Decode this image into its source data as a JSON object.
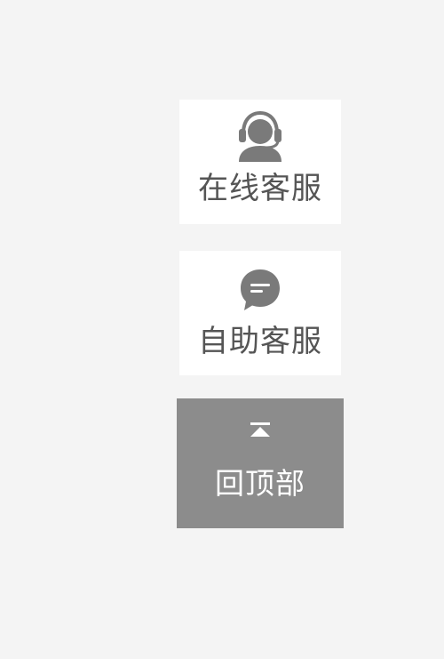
{
  "sidebar": {
    "online_service": {
      "label": "在线客服",
      "icon": "headset-agent-icon"
    },
    "self_service": {
      "label": "自助客服",
      "icon": "chat-bubble-icon"
    },
    "back_to_top": {
      "label": "回顶部",
      "icon": "arrow-to-top-icon"
    }
  },
  "colors": {
    "page_background": "#f4f4f4",
    "card_background": "#ffffff",
    "icon_gray": "#7a7a7a",
    "label_gray": "#555555",
    "back_to_top_background": "#8c8c8c",
    "back_to_top_text": "#ffffff"
  }
}
